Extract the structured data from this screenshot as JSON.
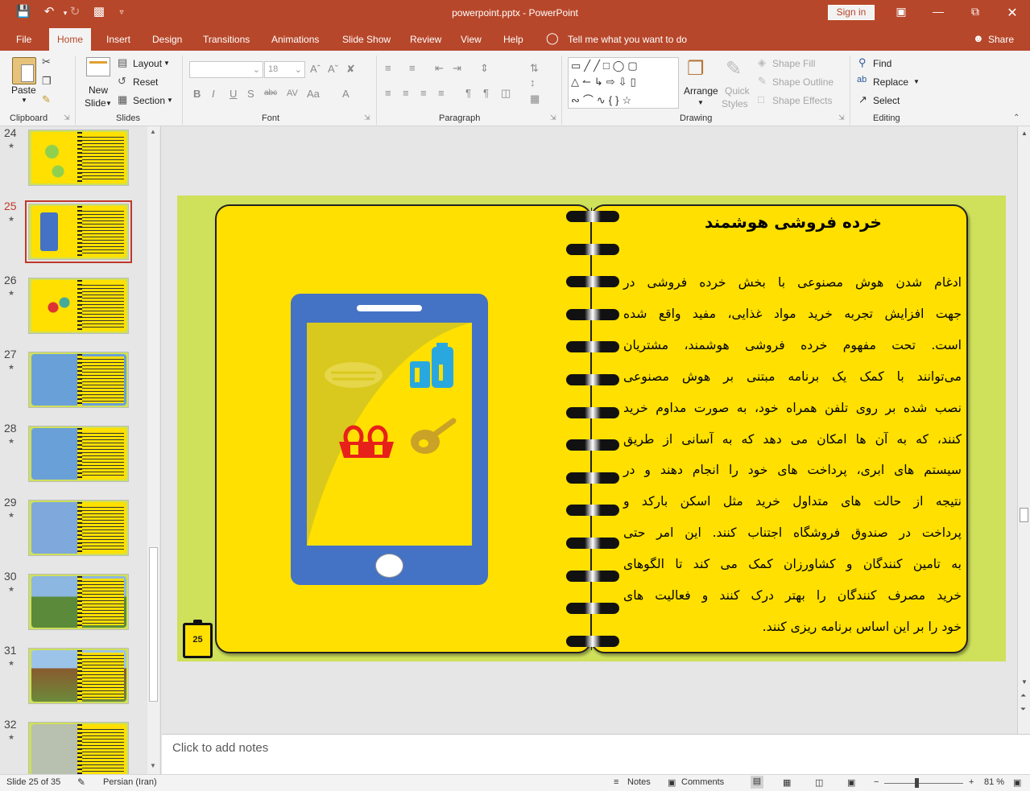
{
  "app": {
    "title": "powerpoint.pptx  -  PowerPoint",
    "signin_label": "Sign in"
  },
  "menu": {
    "tabs": [
      "File",
      "Home",
      "Insert",
      "Design",
      "Transitions",
      "Animations",
      "Slide Show",
      "Review",
      "View",
      "Help"
    ],
    "active_tab": "Home",
    "tell_me": "Tell me what you want to do",
    "share_label": "Share"
  },
  "ribbon": {
    "clipboard": {
      "paste": "Paste",
      "group": "Clipboard"
    },
    "slides": {
      "new_slide_1": "New",
      "new_slide_2": "Slide",
      "layout": "Layout",
      "reset": "Reset",
      "section": "Section",
      "group": "Slides"
    },
    "font": {
      "font_size": "18",
      "group": "Font"
    },
    "paragraph": {
      "group": "Paragraph"
    },
    "drawing": {
      "arrange": "Arrange",
      "quick_styles_1": "Quick",
      "quick_styles_2": "Styles",
      "shape_fill": "Shape Fill",
      "shape_outline": "Shape Outline",
      "shape_effects": "Shape Effects",
      "group": "Drawing"
    },
    "editing": {
      "find": "Find",
      "replace": "Replace",
      "select": "Select",
      "group": "Editing"
    }
  },
  "thumbnails": [
    {
      "num": "24",
      "selected": false
    },
    {
      "num": "25",
      "selected": true
    },
    {
      "num": "26",
      "selected": false
    },
    {
      "num": "27",
      "selected": false
    },
    {
      "num": "28",
      "selected": false
    },
    {
      "num": "29",
      "selected": false
    },
    {
      "num": "30",
      "selected": false
    },
    {
      "num": "31",
      "selected": false
    },
    {
      "num": "32",
      "selected": false
    }
  ],
  "slide": {
    "title": "خرده فروشی هوشمند",
    "body_lines": [
      "ادغام شدن هوش مصنوعی با بخش خرده فروشی در",
      "جهت افزایش تجربه خرید مواد غذایی، مفید واقع شده",
      "است. تحت مفهوم خرده فروشی هوشمند، مشتریان",
      "می‌توانند با کمک یک برنامه مبتنی بر هوش مصنوعی",
      "نصب شده بر روی تلفن همراه خود، به صورت مداوم خرید",
      "کنند، که به آن ها امکان می دهد که به آسانی از طریق",
      "سیستم های ابری، پرداخت های خود را انجام دهند و در",
      "نتیجه از حالت های متداول خرید مثل اسکن بارکد و",
      "پرداخت در صندوق فروشگاه اجتناب کنند. این امر حتی",
      "به تامین کنندگان و کشاورزان کمک می کند تا الگوهای",
      "خرید مصرف کنندگان را بهتر درک کنند و فعالیت های",
      "خود را بر این اساس برنامه ریزی کنند."
    ],
    "slide_number": "25",
    "colors": {
      "background": "#cfe05a",
      "page": "#ffe000",
      "phone": "#4472c4"
    }
  },
  "notes": {
    "placeholder": "Click to add notes"
  },
  "status": {
    "slide_info": "Slide 25 of 35",
    "language": "Persian (Iran)",
    "notes_label": "Notes",
    "comments_label": "Comments",
    "zoom": "81 %"
  }
}
